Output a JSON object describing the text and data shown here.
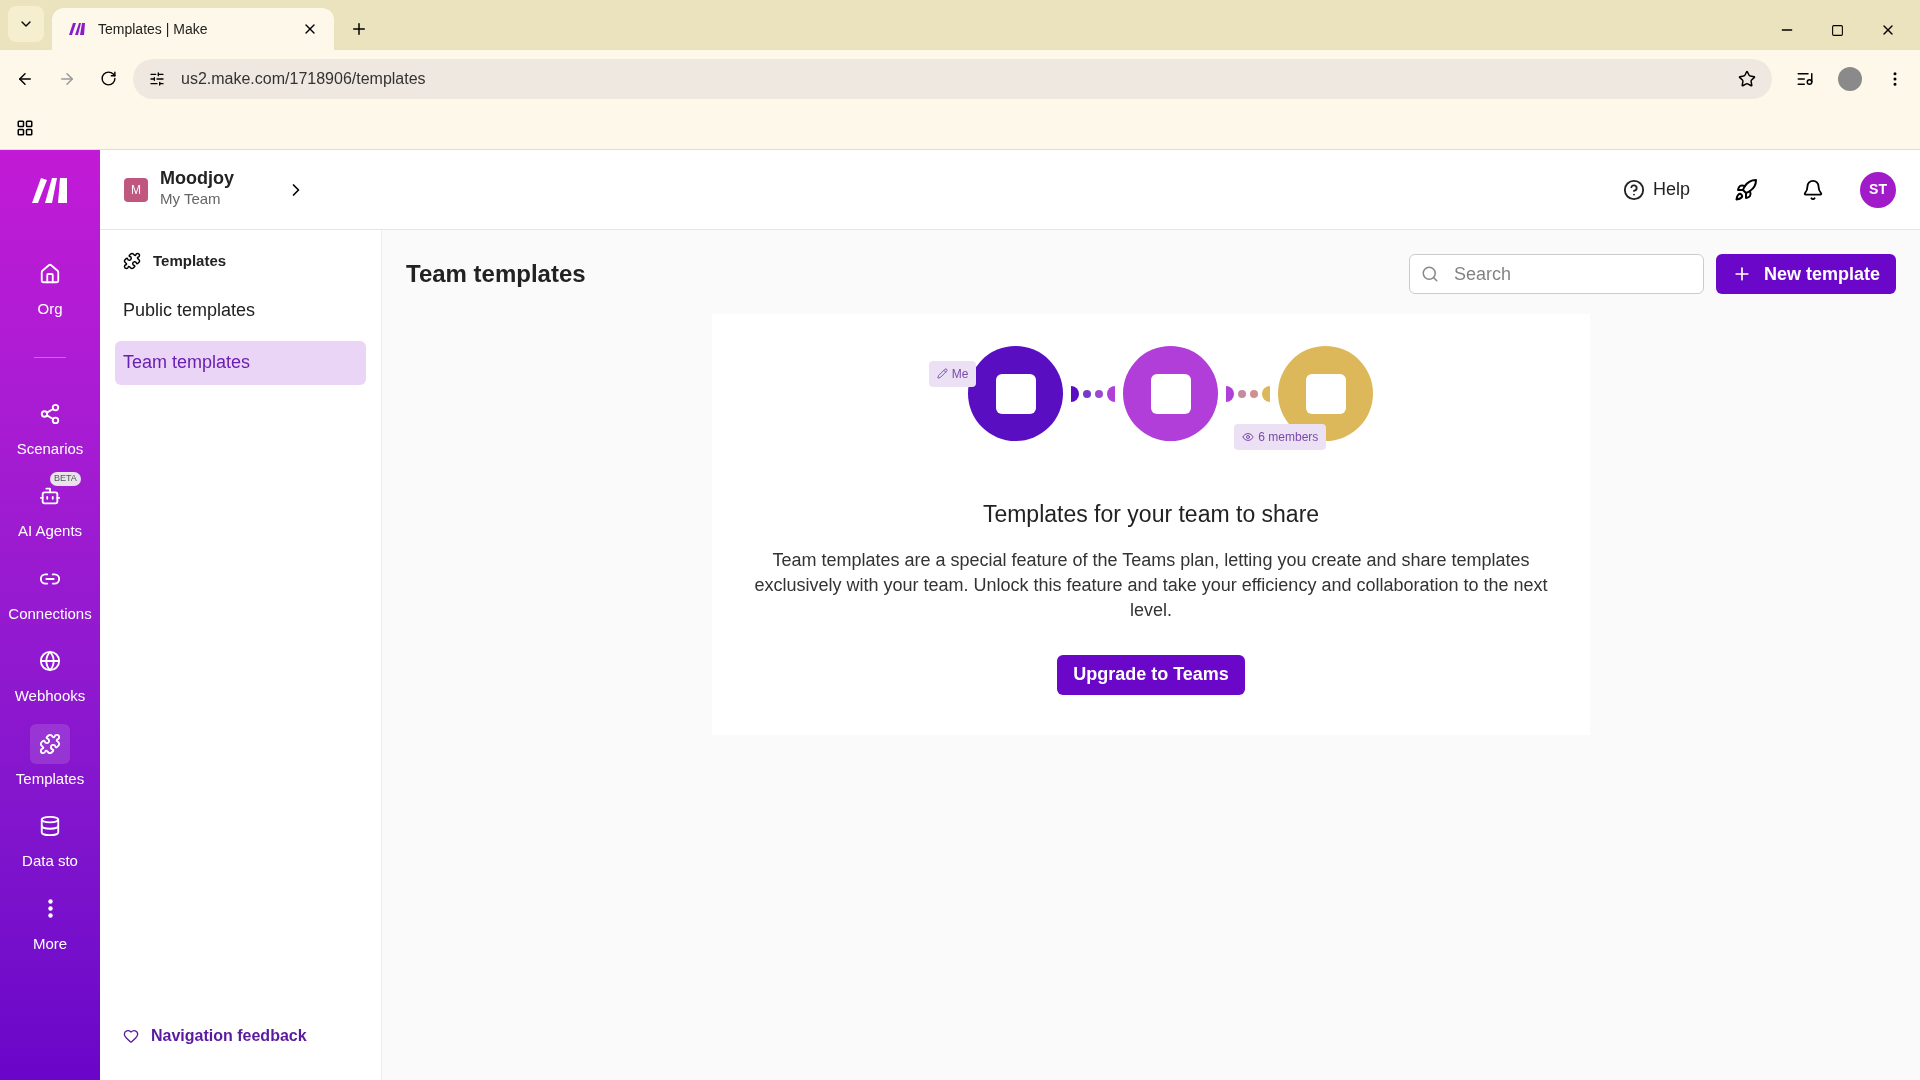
{
  "browser": {
    "tab_title": "Templates | Make",
    "url": "us2.make.com/1718906/templates"
  },
  "org": {
    "avatar": "M",
    "name": "Moodjoy",
    "team": "My Team"
  },
  "header": {
    "help": "Help",
    "avatar": "ST"
  },
  "nav": [
    {
      "kind": "home",
      "label": "Org",
      "selected": false
    },
    {
      "kind": "divider"
    },
    {
      "kind": "scenarios",
      "label": "Scenarios",
      "selected": false
    },
    {
      "kind": "agents",
      "label": "AI Agents",
      "badge": "BETA",
      "selected": false
    },
    {
      "kind": "connections",
      "label": "Connections",
      "selected": false
    },
    {
      "kind": "webhooks",
      "label": "Webhooks",
      "selected": false
    },
    {
      "kind": "templates",
      "label": "Templates",
      "selected": true
    },
    {
      "kind": "datastores",
      "label": "Data sto",
      "selected": false
    },
    {
      "kind": "more",
      "label": "More",
      "selected": false
    }
  ],
  "subnav": {
    "title": "Templates",
    "items": [
      {
        "label": "Public templates",
        "selected": false
      },
      {
        "label": "Team templates",
        "selected": true
      }
    ],
    "feedback": "Navigation feedback"
  },
  "page": {
    "title": "Team templates",
    "search_placeholder": "Search",
    "new_button": "New template"
  },
  "empty_state": {
    "me_tag": "Me",
    "members_tag": "6 members",
    "heading": "Templates for your team to share",
    "body": "Team templates are a special feature of the Teams plan, letting you create and share templates exclusively with your team. Unlock this feature and take your efficiency and collaboration to the next level.",
    "button": "Upgrade to Teams"
  }
}
